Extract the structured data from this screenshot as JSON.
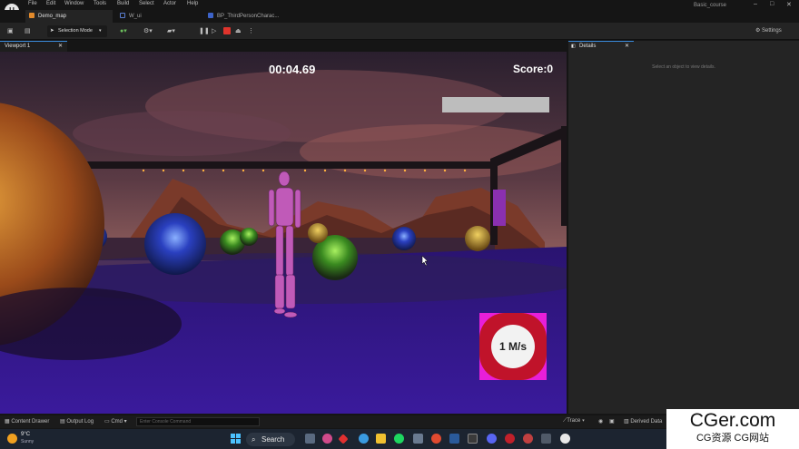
{
  "menu": {
    "items": [
      "File",
      "Edit",
      "Window",
      "Tools",
      "Build",
      "Select",
      "Actor",
      "Help"
    ]
  },
  "project_name": "Basic_course",
  "tabs": [
    {
      "label": "Demo_map",
      "icon": "map-icon"
    },
    {
      "label": "W_ui",
      "icon": "widget-icon"
    },
    {
      "label": "BP_ThirdPersonCharac...",
      "icon": "blueprint-icon"
    }
  ],
  "toolbar": {
    "selection_mode": "Selection Mode",
    "settings": "Settings"
  },
  "viewport": {
    "tab_label": "Viewport 1"
  },
  "hud": {
    "timer": "00:04.69",
    "score": "Score:0",
    "speed": "1 M/s"
  },
  "details": {
    "tab_label": "Details",
    "empty_message": "Select an object to view details."
  },
  "bottom": {
    "content_drawer": "Content Drawer",
    "output_log": "Output Log",
    "cmd": "Cmd",
    "console_placeholder": "Enter Console Command",
    "trace": "Trace",
    "derived_data": "Derived Data"
  },
  "weather": {
    "temp": "9°C",
    "condition": "Sunny"
  },
  "taskbar": {
    "search": "Search"
  },
  "watermark": {
    "top": "CGer.com",
    "bottom": "CG资源 CG网站"
  },
  "colors": {
    "accent": "#3b8ee0",
    "floor": "#3a1a9c",
    "speed_bg": "#c0132a",
    "speed_corner": "#e81fd8"
  }
}
